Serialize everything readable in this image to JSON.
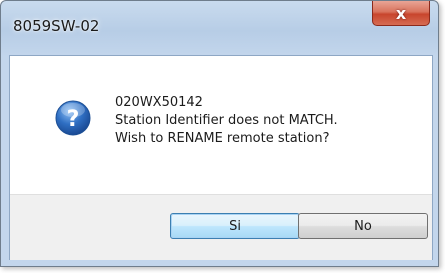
{
  "window": {
    "title": "8059SW-02",
    "close_glyph": "x"
  },
  "message": {
    "icon": "question-icon",
    "lines": [
      "020WX50142",
      "Station Identifier does not MATCH.",
      "Wish to RENAME remote station?"
    ]
  },
  "buttons": {
    "yes_label": "Si",
    "no_label": "No"
  },
  "colors": {
    "accent": "#2f6fc3",
    "close_button": "#c8452d"
  }
}
